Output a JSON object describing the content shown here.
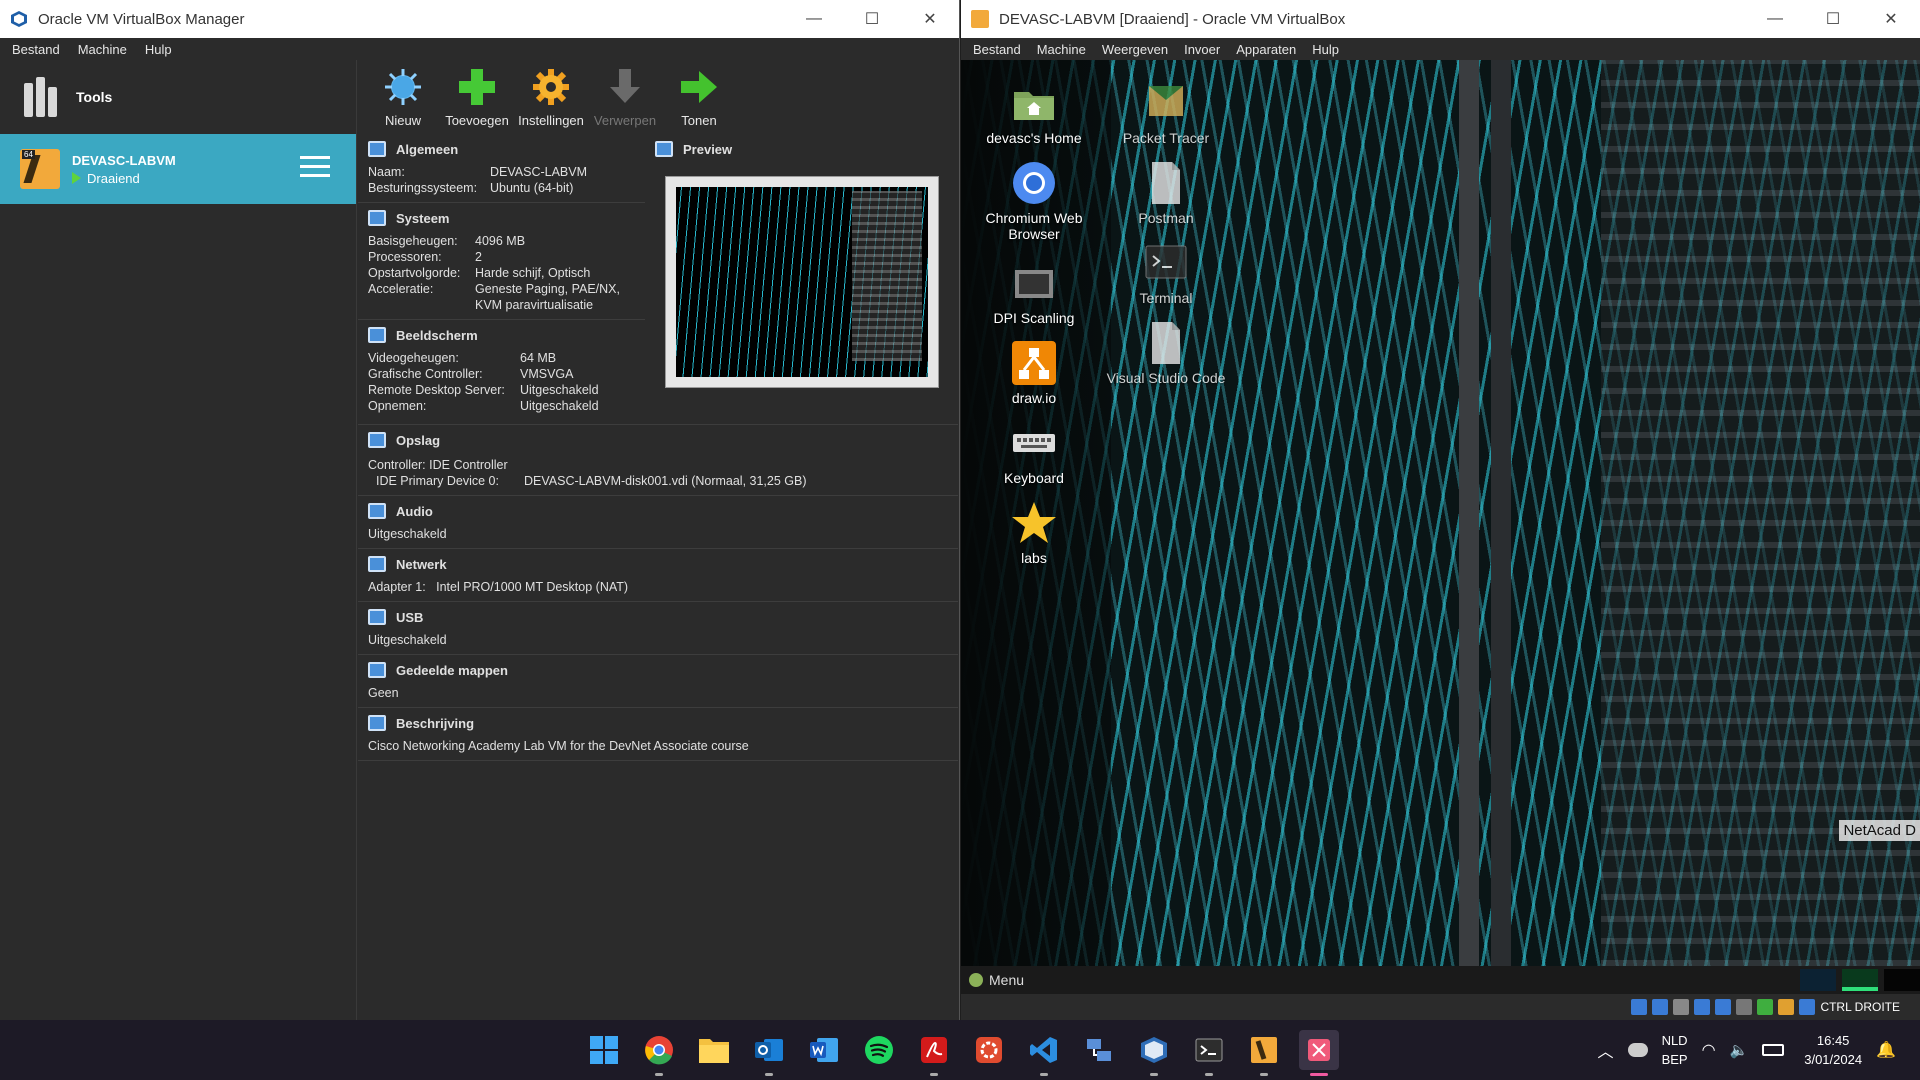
{
  "manager": {
    "title": "Oracle VM VirtualBox Manager",
    "menu": [
      "Bestand",
      "Machine",
      "Hulp"
    ],
    "tools_label": "Tools",
    "vm": {
      "name": "DEVASC-LABVM",
      "state": "Draaiend",
      "badge": "64"
    },
    "toolbar": [
      {
        "label": "Nieuw",
        "icon": "new-icon",
        "enabled": true
      },
      {
        "label": "Toevoegen",
        "icon": "add-icon",
        "enabled": true
      },
      {
        "label": "Instellingen",
        "icon": "settings-icon",
        "enabled": true
      },
      {
        "label": "Verwerpen",
        "icon": "discard-icon",
        "enabled": false
      },
      {
        "label": "Tonen",
        "icon": "show-icon",
        "enabled": true
      }
    ],
    "details": {
      "general": {
        "title": "Algemeen",
        "rows": [
          {
            "k": "Naam:",
            "v": "DEVASC-LABVM"
          },
          {
            "k": "Besturingssysteem:",
            "v": "Ubuntu (64-bit)"
          }
        ]
      },
      "preview": {
        "title": "Preview"
      },
      "system": {
        "title": "Systeem",
        "rows": [
          {
            "k": "Basisgeheugen:",
            "v": "4096 MB"
          },
          {
            "k": "Processoren:",
            "v": "2"
          },
          {
            "k": "Opstartvolgorde:",
            "v": "Harde schijf, Optisch"
          },
          {
            "k": "Acceleratie:",
            "v": "Geneste Paging, PAE/NX,"
          },
          {
            "k": "",
            "v": "KVM paravirtualisatie"
          }
        ]
      },
      "display": {
        "title": "Beeldscherm",
        "rows": [
          {
            "k": "Videogeheugen:",
            "v": "64 MB"
          },
          {
            "k": "Grafische Controller:",
            "v": "VMSVGA"
          },
          {
            "k": "Remote Desktop Server:",
            "v": "Uitgeschakeld"
          },
          {
            "k": "Opnemen:",
            "v": "Uitgeschakeld"
          }
        ]
      },
      "storage": {
        "title": "Opslag",
        "line1": "Controller: IDE Controller",
        "line2_k": "IDE Primary Device 0:",
        "line2_v": "DEVASC-LABVM-disk001.vdi (Normaal, 31,25 GB)"
      },
      "audio": {
        "title": "Audio",
        "value": "Uitgeschakeld"
      },
      "network": {
        "title": "Netwerk",
        "value": "Adapter 1:   Intel PRO/1000 MT Desktop (NAT)"
      },
      "usb": {
        "title": "USB",
        "value": "Uitgeschakeld"
      },
      "shared": {
        "title": "Gedeelde mappen",
        "value": "Geen"
      },
      "description": {
        "title": "Beschrijving",
        "value": "Cisco Networking Academy Lab VM for the DevNet Associate course"
      }
    }
  },
  "vmwindow": {
    "title": "DEVASC-LABVM [Draaiend] - Oracle VM VirtualBox",
    "menu": [
      "Bestand",
      "Machine",
      "Weergeven",
      "Invoer",
      "Apparaten",
      "Hulp"
    ],
    "desktop_icons_col1": [
      {
        "label": "devasc's Home",
        "icon": "home-folder-icon"
      },
      {
        "label": "Chromium Web Browser",
        "icon": "chromium-icon"
      },
      {
        "label": "DPI Scanling",
        "icon": "dpi-icon"
      },
      {
        "label": "draw.io",
        "icon": "drawio-icon"
      },
      {
        "label": "Keyboard",
        "icon": "keyboard-icon"
      },
      {
        "label": "labs",
        "icon": "star-icon"
      }
    ],
    "desktop_icons_col2": [
      {
        "label": "Packet Tracer",
        "icon": "packet-tracer-icon"
      },
      {
        "label": "Postman",
        "icon": "file-icon"
      },
      {
        "label": "Terminal",
        "icon": "terminal-icon"
      },
      {
        "label": "Visual Studio Code",
        "icon": "file-icon"
      }
    ],
    "netacad_text": "NetAcad D",
    "panel_menu": "Menu",
    "host_key": "CTRL DROITE"
  },
  "taskbar": {
    "lang": "NLD",
    "layout": "BEP",
    "time": "16:45",
    "date": "3/01/2024"
  }
}
